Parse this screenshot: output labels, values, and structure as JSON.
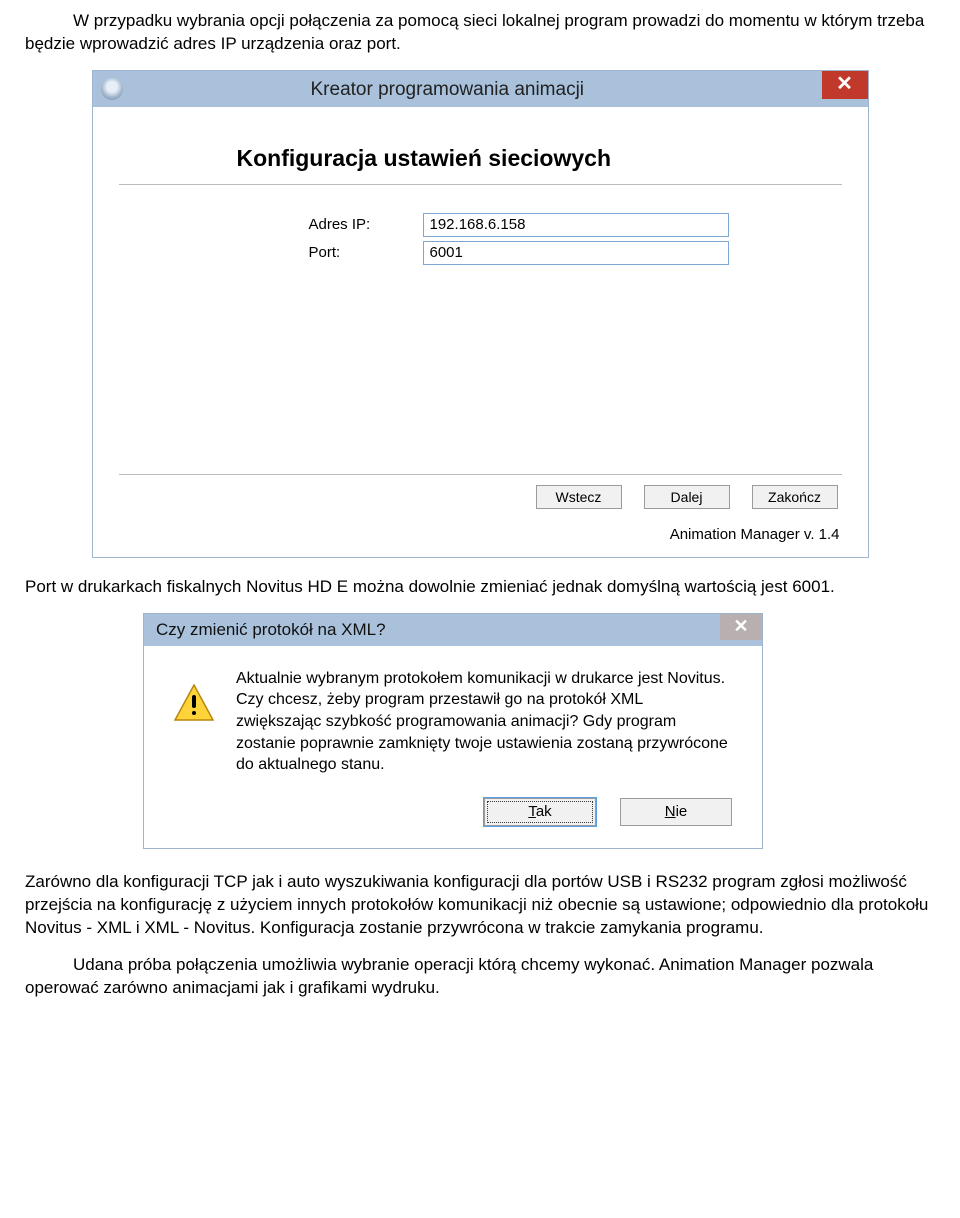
{
  "para1": "W przypadku wybrania opcji połączenia za pomocą sieci lokalnej program prowadzi do momentu w którym trzeba będzie wprowadzić adres IP urządzenia oraz port.",
  "win1": {
    "title": "Kreator programowania animacji",
    "heading": "Konfiguracja ustawień sieciowych",
    "field_ip_label": "Adres IP:",
    "field_ip_value": "192.168.6.158",
    "field_port_label": "Port:",
    "field_port_value": "6001",
    "btn_back": "Wstecz",
    "btn_next": "Dalej",
    "btn_finish": "Zakończ",
    "version": "Animation Manager v. 1.4",
    "close_glyph": "✕"
  },
  "para2": "Port w drukarkach fiskalnych Novitus HD E można dowolnie zmieniać jednak domyślną wartością jest 6001.",
  "win2": {
    "title": "Czy zmienić protokół na XML?",
    "message": "Aktualnie wybranym protokołem komunikacji w drukarce jest Novitus. Czy chcesz, żeby program przestawił go na protokół XML zwiększając szybkość programowania animacji? Gdy program zostanie poprawnie zamknięty twoje ustawienia zostaną przywrócone do aktualnego stanu.",
    "btn_yes_u": "T",
    "btn_yes_rest": "ak",
    "btn_no_u": "N",
    "btn_no_rest": "ie",
    "close_glyph": "✕"
  },
  "para3": "Zarówno dla konfiguracji TCP jak i auto wyszukiwania konfiguracji dla portów USB i RS232 program zgłosi możliwość przejścia na konfigurację z użyciem innych protokołów komunikacji niż obecnie są ustawione; odpowiednio dla protokołu Novitus - XML i XML - Novitus. Konfiguracja zostanie przywrócona w trakcie zamykania programu.",
  "para4": "Udana próba połączenia umożliwia wybranie operacji którą chcemy wykonać. Animation Manager pozwala operować zarówno animacjami jak i grafikami wydruku."
}
